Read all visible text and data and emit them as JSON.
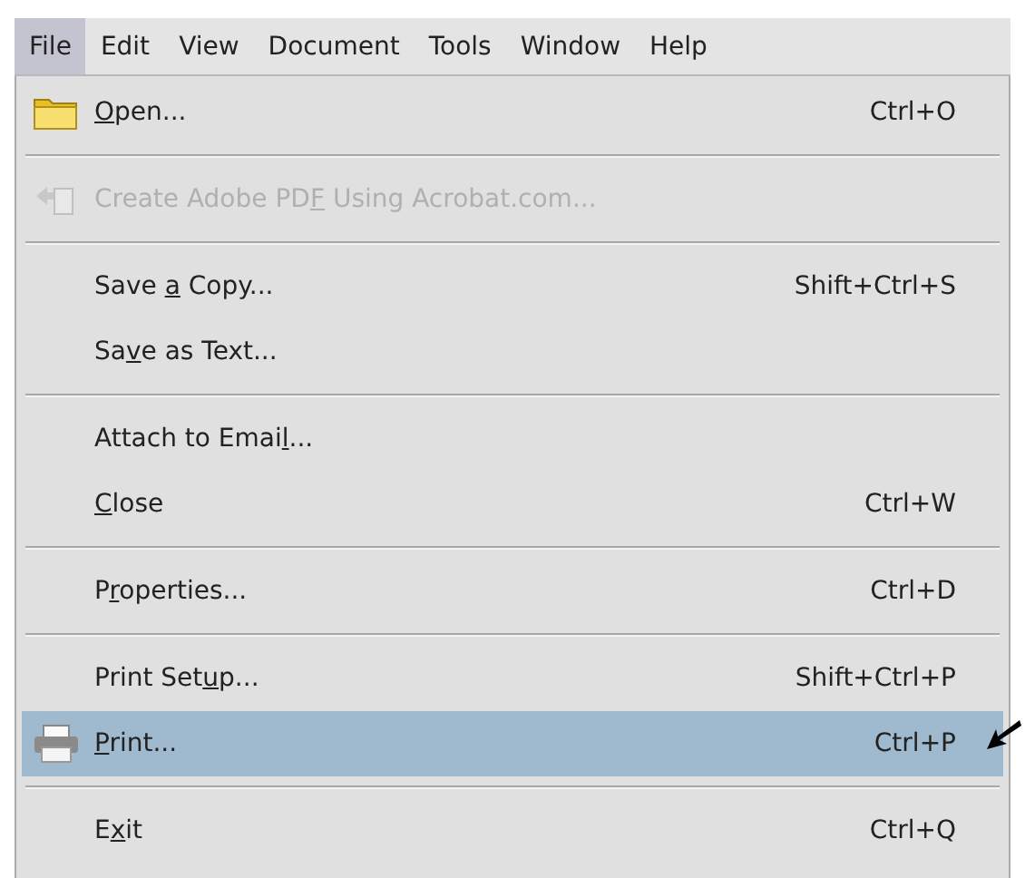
{
  "menu_bar": [
    {
      "label": "File",
      "selected": true
    },
    {
      "label": "Edit",
      "selected": false
    },
    {
      "label": "View",
      "selected": false
    },
    {
      "label": "Document",
      "selected": false
    },
    {
      "label": "Tools",
      "selected": false
    },
    {
      "label": "Window",
      "selected": false
    },
    {
      "label": "Help",
      "selected": false
    }
  ],
  "menu": [
    {
      "kind": "item",
      "label": {
        "key": "O",
        "after": "pen..."
      },
      "shortcut": "Ctrl+O",
      "disabled": false,
      "selected": false
    },
    {
      "kind": "separator"
    },
    {
      "kind": "item",
      "label": {
        "before": "Create Adobe PD",
        "key": "F",
        "after": " Using Acrobat.com..."
      },
      "disabled": true,
      "selected": false
    },
    {
      "kind": "separator"
    },
    {
      "kind": "item",
      "label": {
        "before": "Save ",
        "key": "a",
        "after": " Copy..."
      },
      "shortcut": "Shift+Ctrl+S",
      "disabled": false,
      "selected": false
    },
    {
      "kind": "item",
      "label": {
        "before": "Sa",
        "key": "v",
        "after": "e as Text..."
      },
      "disabled": false,
      "selected": false
    },
    {
      "kind": "separator"
    },
    {
      "kind": "item",
      "label": {
        "before": "Attach to Emai",
        "key": "l",
        "after": "..."
      },
      "disabled": false,
      "selected": false
    },
    {
      "kind": "item",
      "label": {
        "key": "C",
        "after": "lose"
      },
      "shortcut": "Ctrl+W",
      "disabled": false,
      "selected": false
    },
    {
      "kind": "separator"
    },
    {
      "kind": "item",
      "label": {
        "before": "P",
        "key": "r",
        "after": "operties..."
      },
      "shortcut": "Ctrl+D",
      "disabled": false,
      "selected": false
    },
    {
      "kind": "separator"
    },
    {
      "kind": "item",
      "label": {
        "before": "Print Set",
        "key": "u",
        "after": "p..."
      },
      "shortcut": "Shift+Ctrl+P",
      "disabled": false,
      "selected": false
    },
    {
      "kind": "item",
      "label": {
        "key": "P",
        "after": "rint..."
      },
      "shortcut": "Ctrl+P",
      "disabled": false,
      "selected": true
    },
    {
      "kind": "separator"
    },
    {
      "kind": "item",
      "label": {
        "before": "E",
        "key": "x",
        "after": "it"
      },
      "shortcut": "Ctrl+Q",
      "disabled": false,
      "selected": false
    }
  ]
}
